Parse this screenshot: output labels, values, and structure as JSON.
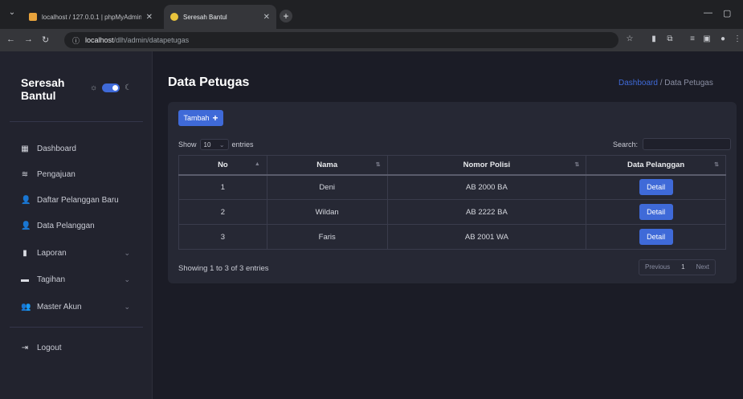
{
  "browser": {
    "tabs": [
      {
        "title": "localhost / 127.0.0.1 | phpMyAdmin",
        "active": false
      },
      {
        "title": "Seresah Bantul",
        "active": true
      }
    ],
    "url_host": "localhost",
    "url_path": "/dlh/admin/datapetugas"
  },
  "sidebar": {
    "brand": "Seresah Bantul",
    "items": [
      {
        "label": "Dashboard",
        "icon": "grid-icon",
        "glyph": "▦"
      },
      {
        "label": "Pengajuan",
        "icon": "layers-icon",
        "glyph": "≋"
      },
      {
        "label": "Daftar Pelanggan Baru",
        "icon": "user-plus-icon",
        "glyph": "👤"
      },
      {
        "label": "Data Pelanggan",
        "icon": "user-icon",
        "glyph": "👤"
      },
      {
        "label": "Laporan",
        "icon": "file-icon",
        "glyph": "▮"
      },
      {
        "label": "Tagihan",
        "icon": "wallet-icon",
        "glyph": "▬"
      },
      {
        "label": "Master Akun",
        "icon": "users-icon",
        "glyph": "👥"
      },
      {
        "label": "Logout",
        "icon": "logout-icon",
        "glyph": "⇥"
      }
    ]
  },
  "header": {
    "title": "Data Petugas",
    "breadcrumb_home": "Dashboard",
    "breadcrumb_sep": "/",
    "breadcrumb_current": "Data Petugas"
  },
  "main": {
    "add_button": "Tambah",
    "show_label": "Show",
    "entries_label": "entries",
    "page_length": "10",
    "search_label": "Search:",
    "search_value": "",
    "columns": [
      "No",
      "Nama",
      "Nomor Polisi",
      "Data Pelanggan"
    ],
    "rows": [
      {
        "no": "1",
        "nama": "Deni",
        "polisi": "AB 2000 BA",
        "action": "Detail"
      },
      {
        "no": "2",
        "nama": "Wildan",
        "polisi": "AB 2222 BA",
        "action": "Detail"
      },
      {
        "no": "3",
        "nama": "Faris",
        "polisi": "AB 2001 WA",
        "action": "Detail"
      }
    ],
    "info": "Showing 1 to 3 of 3 entries",
    "pagination": {
      "prev": "Previous",
      "page": "1",
      "next": "Next"
    }
  },
  "colors": {
    "accent": "#3f6ad8",
    "background": "#1b1c26",
    "card": "#262834",
    "sidebar": "#22232e"
  }
}
